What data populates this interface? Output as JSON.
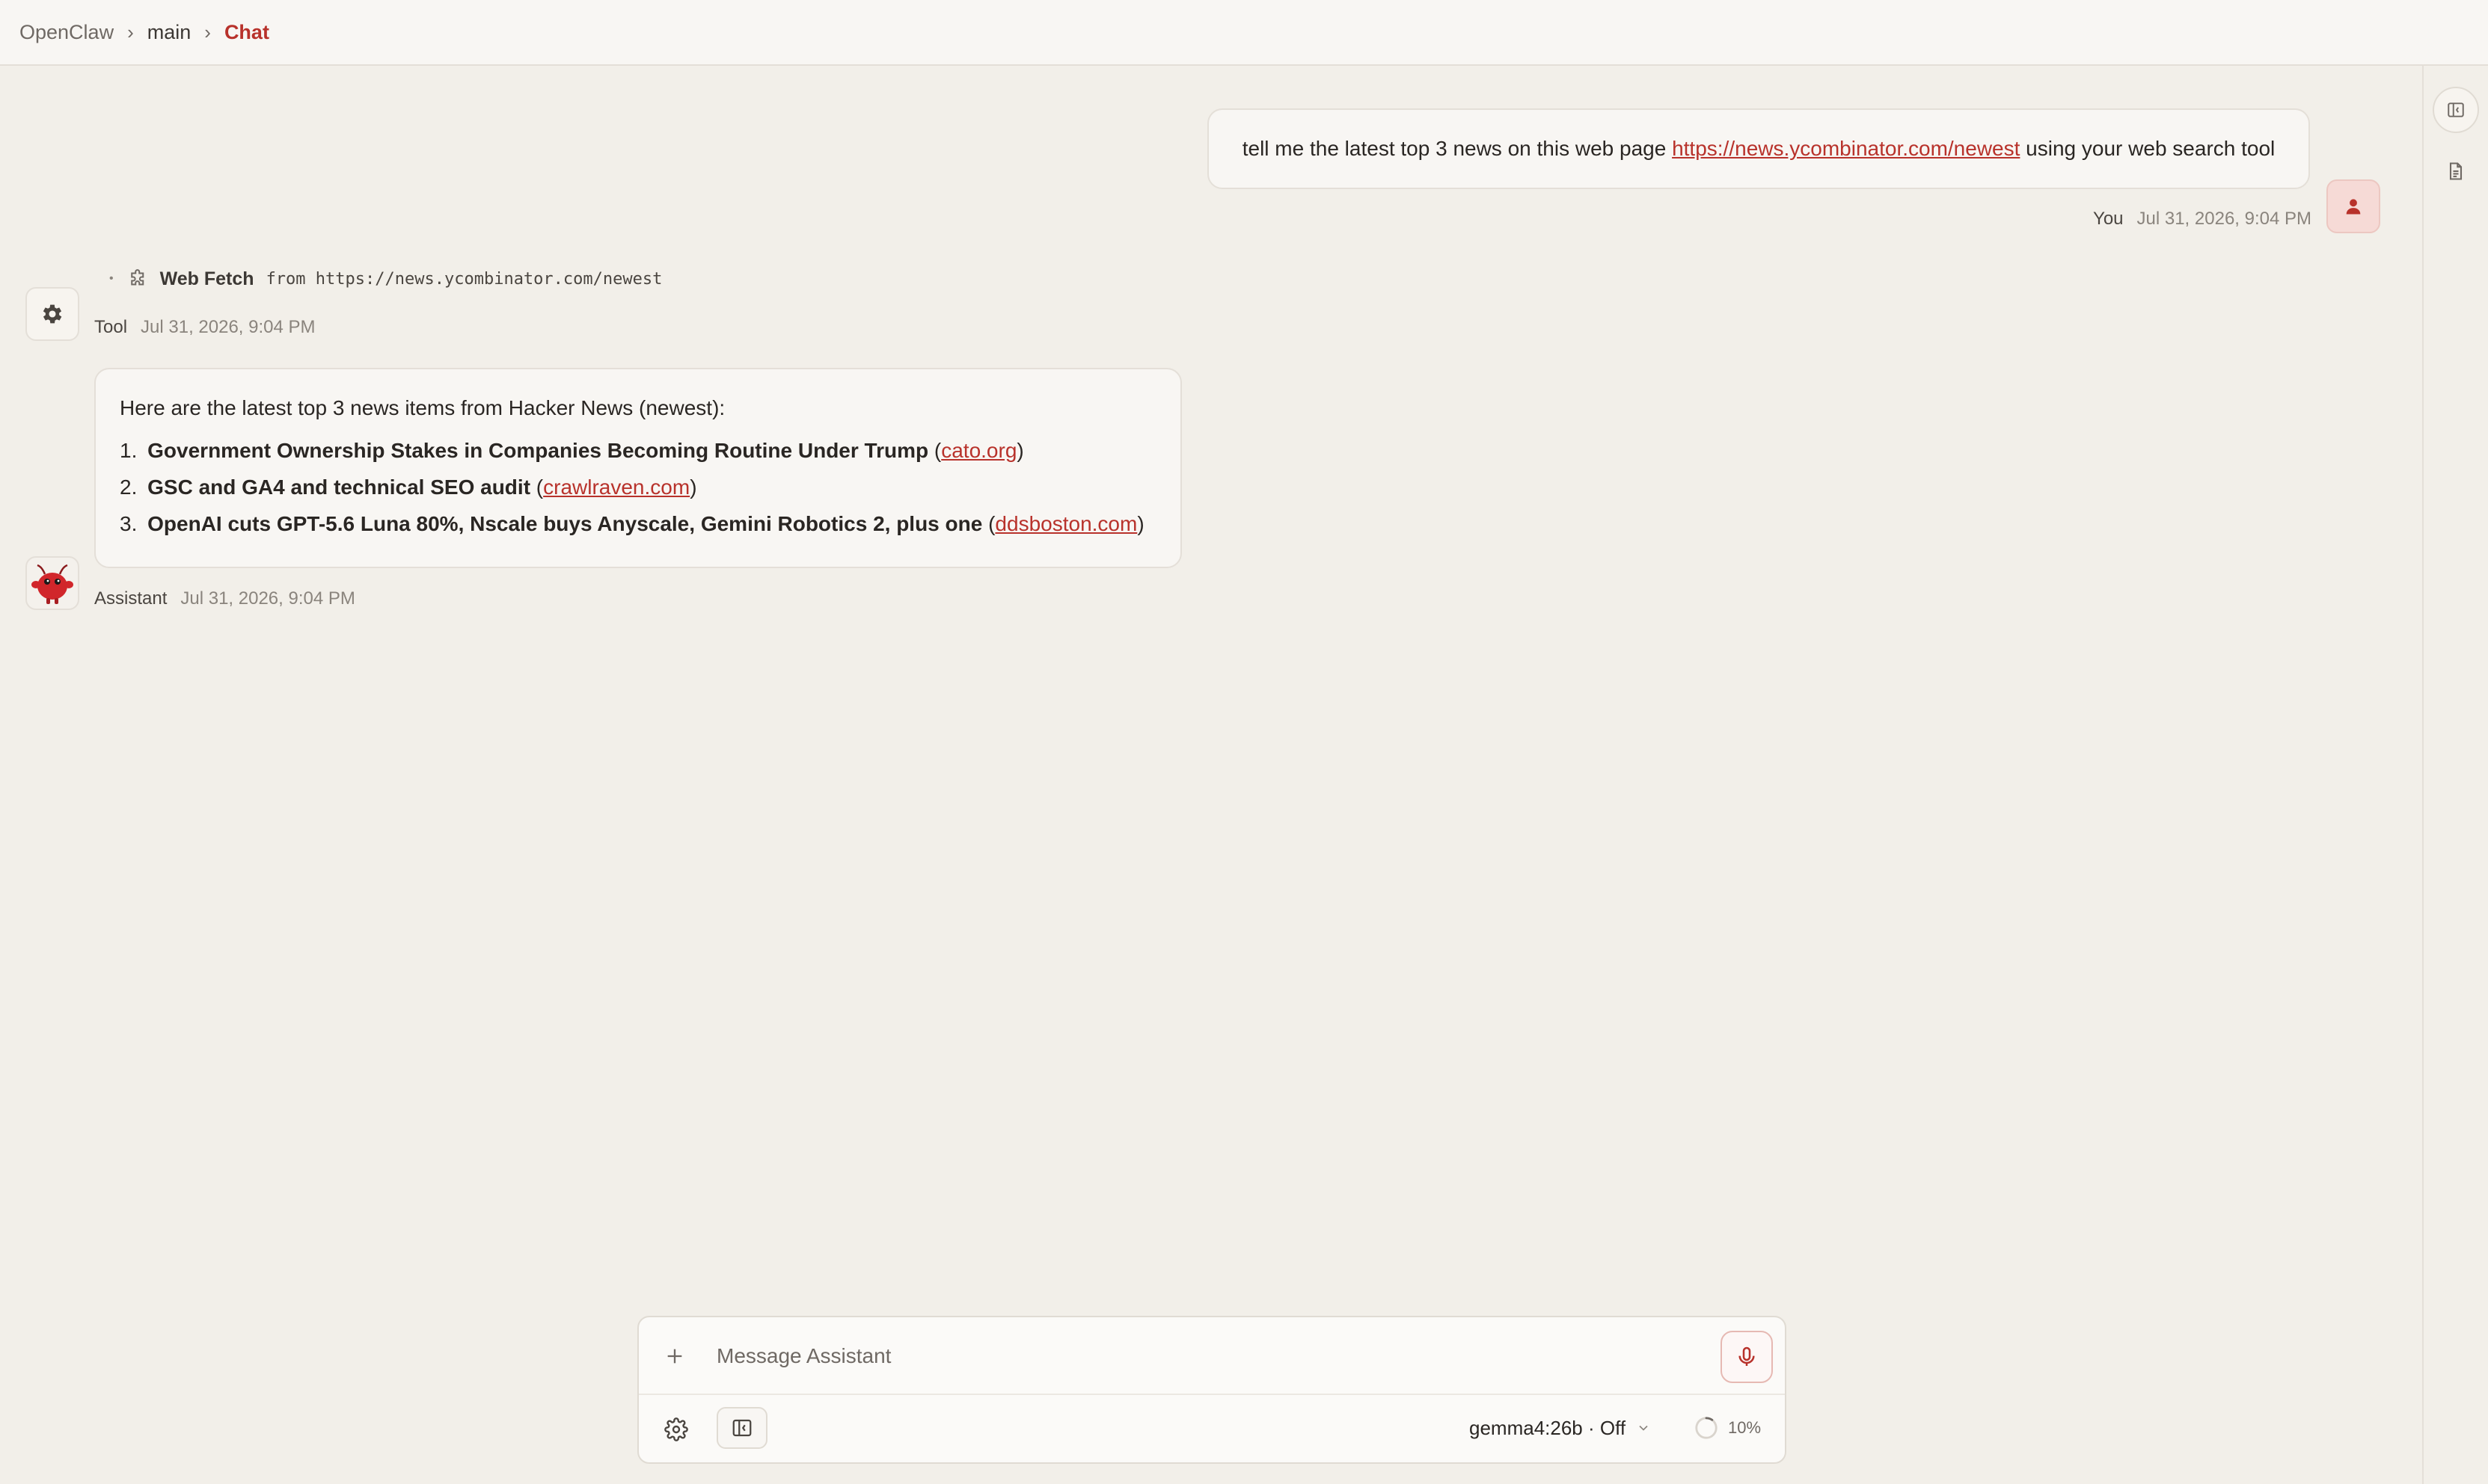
{
  "breadcrumb": {
    "root": "OpenClaw",
    "branch": "main",
    "current": "Chat",
    "separator": "›"
  },
  "rail": {
    "items": [
      {
        "icon": "sidebar-panel-icon"
      },
      {
        "icon": "document-icon"
      }
    ]
  },
  "messages": {
    "user": {
      "text_before": "tell me the latest top 3 news on this web page ",
      "link": "https://news.ycombinator.com/newest",
      "text_after": " using your web search tool",
      "author": "You",
      "timestamp": "Jul 31, 2026, 9:04 PM"
    },
    "tool": {
      "bullet": "•",
      "name": "Web Fetch",
      "source": "from https://news.ycombinator.com/newest",
      "author": "Tool",
      "timestamp": "Jul 31, 2026, 9:04 PM"
    },
    "assistant": {
      "intro": "Here are the latest top 3 news items from Hacker News (newest):",
      "items": [
        {
          "num": "1.",
          "title": "Government Ownership Stakes in Companies Becoming Routine Under Trump",
          "source": "cato.org"
        },
        {
          "num": "2.",
          "title": "GSC and GA4 and technical SEO audit",
          "source": "crawlraven.com"
        },
        {
          "num": "3.",
          "title": "OpenAI cuts GPT-5.6 Luna 80%, Nscale buys Anyscale, Gemini Robotics 2, plus one",
          "source": "ddsboston.com"
        }
      ],
      "author": "Assistant",
      "timestamp": "Jul 31, 2026, 9:04 PM"
    }
  },
  "composer": {
    "placeholder": "Message Assistant",
    "value": "",
    "model": "gemma4:26b · Off",
    "context_usage": "10%",
    "context_fraction": 0.1
  },
  "colors": {
    "accent": "#b8322b",
    "background": "#f2efe9",
    "surface": "#f8f6f3",
    "border": "#e4dfd8"
  }
}
